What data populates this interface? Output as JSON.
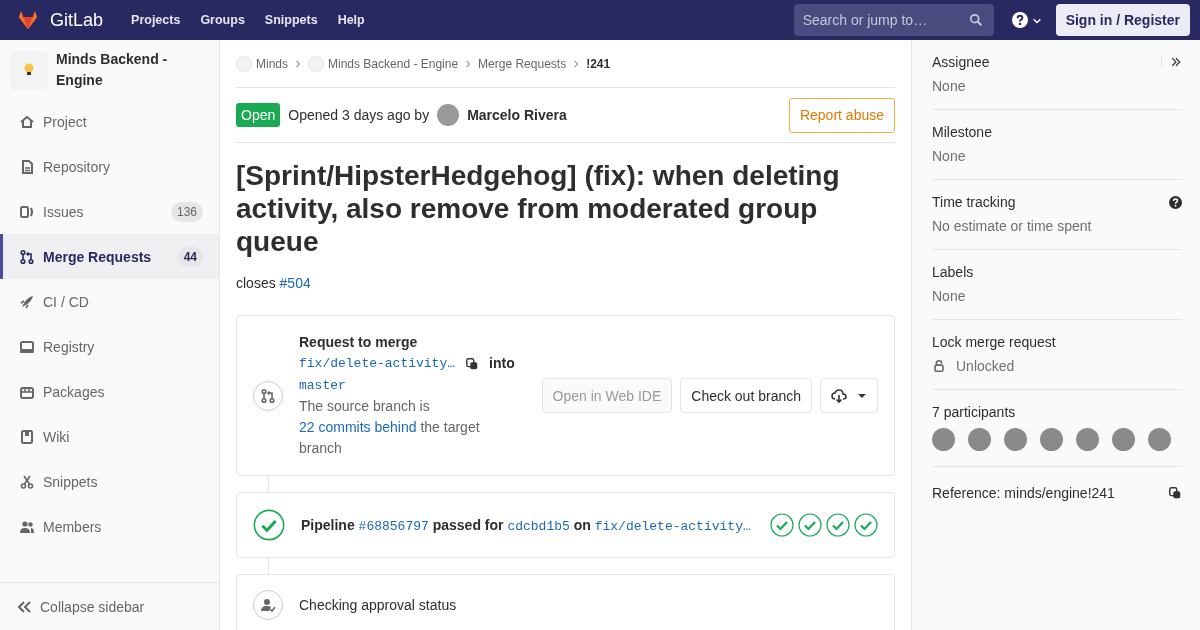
{
  "header": {
    "logo": "GitLab",
    "nav": [
      "Projects",
      "Groups",
      "Snippets",
      "Help"
    ],
    "search": {
      "placeholder": "Search or jump to…"
    },
    "sign_in": "Sign in / Register"
  },
  "sidebar": {
    "project": "Minds Backend - Engine",
    "items": [
      {
        "label": "Project",
        "selected": false
      },
      {
        "label": "Repository",
        "selected": false
      },
      {
        "label": "Issues",
        "count": "136",
        "selected": false
      },
      {
        "label": "Merge Requests",
        "count": "44",
        "selected": true
      },
      {
        "label": "CI / CD",
        "selected": false
      },
      {
        "label": "Registry",
        "selected": false
      },
      {
        "label": "Packages",
        "selected": false
      },
      {
        "label": "Wiki",
        "selected": false
      },
      {
        "label": "Snippets",
        "selected": false
      },
      {
        "label": "Members",
        "selected": false
      }
    ],
    "collapse": "Collapse sidebar"
  },
  "breadcrumbs": [
    {
      "label": "Minds",
      "kind": "project"
    },
    {
      "label": "Minds Backend - Engine",
      "kind": "project"
    },
    {
      "label": "Merge Requests",
      "kind": "link"
    },
    {
      "label": "!241",
      "kind": "current"
    }
  ],
  "status": {
    "state": "Open",
    "text": "Opened 3 days ago by",
    "author": "Marcelo Rivera",
    "report": "Report abuse"
  },
  "title": "[Sprint/HipsterHedgehog] (fix): when deleting activity, also remove from moderated group queue",
  "description": {
    "text": "closes",
    "link": "#504"
  },
  "merge_widget": {
    "heading": "Request to merge",
    "source_branch": "fix/delete-activity…",
    "into": "into",
    "target_branch": "master",
    "behind_prefix": "The source branch is",
    "behind_link": "22 commits behind",
    "behind_suffix": "the target branch",
    "buttons": [
      {
        "label": "Open in Web IDE",
        "disabled": true
      },
      {
        "label": "Check out branch",
        "disabled": false
      }
    ]
  },
  "pipeline": {
    "label": "Pipeline",
    "id": "#68856797",
    "passed_for": "passed for",
    "sha": "cdcbd1b5",
    "on": "on",
    "branch": "fix/delete-activity…",
    "stages": [
      {
        "passed": true
      },
      {
        "passed": true
      },
      {
        "passed": true
      },
      {
        "passed": true
      }
    ]
  },
  "approval": {
    "text": "Checking approval status"
  },
  "right_sidebar": {
    "blocks": [
      {
        "title": "Assignee",
        "value": "None",
        "kind": "collapse"
      },
      {
        "title": "Milestone",
        "value": "None",
        "kind": "plain"
      },
      {
        "title": "Time tracking",
        "value": "No estimate or time spent",
        "kind": "help"
      },
      {
        "title": "Labels",
        "value": "None",
        "kind": "plain"
      },
      {
        "title": "Lock merge request",
        "value": "Unlocked",
        "kind": "lock"
      }
    ],
    "participants": {
      "title": "7 participants",
      "avatars": [
        {
          "kind": "photo"
        },
        {
          "kind": "photo"
        },
        {
          "kind": "photo"
        },
        {
          "kind": "photo"
        },
        {
          "kind": "photo"
        },
        {
          "kind": "photo"
        },
        {
          "kind": "photo"
        }
      ]
    },
    "reference": "Reference: minds/engine!241"
  }
}
